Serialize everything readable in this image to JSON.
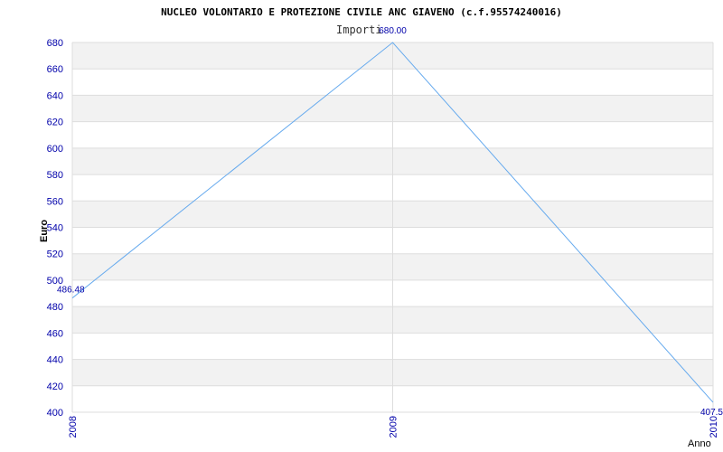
{
  "chart_data": {
    "type": "line",
    "title": "NUCLEO VOLONTARIO E PROTEZIONE CIVILE ANC GIAVENO (c.f.95574240016)",
    "legend": "Importi",
    "xlabel": "Anno",
    "ylabel": "Euro",
    "categories": [
      "2008",
      "2009",
      "2010"
    ],
    "series": [
      {
        "name": "Importi",
        "values": [
          486.48,
          680.0,
          407.5
        ],
        "labels": [
          "486.48",
          "680.00",
          "407.5"
        ]
      }
    ],
    "ylim": [
      400,
      680
    ],
    "yticks": [
      400,
      420,
      440,
      460,
      480,
      500,
      520,
      540,
      560,
      580,
      600,
      620,
      640,
      660,
      680
    ],
    "grid": true,
    "colors": {
      "line": "#66aaee",
      "tick": "#0000aa",
      "band": "#f2f2f2",
      "grid": "#dddddd"
    }
  }
}
